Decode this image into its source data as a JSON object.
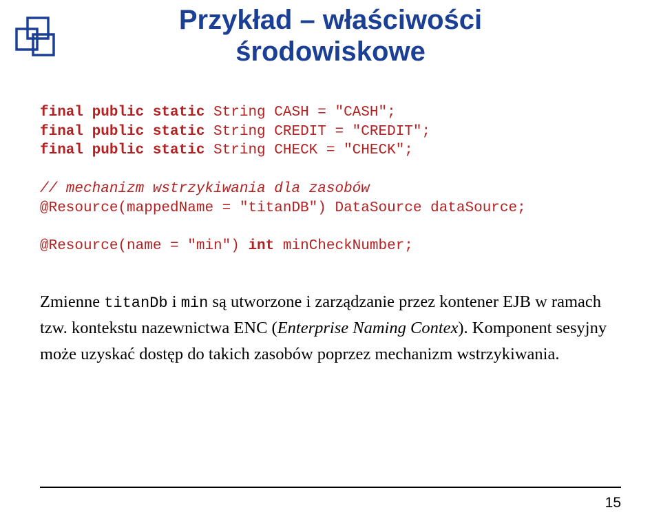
{
  "title_line1": "Przykład – właściwości",
  "title_line2": "środowiskowe",
  "code": {
    "l1a": "final public static ",
    "l1b": "String CASH = \"CASH\";",
    "l2a": "final public static ",
    "l2b": "String CREDIT = \"CREDIT\";",
    "l3a": "final public static ",
    "l3b": "String CHECK = \"CHECK\";",
    "l4": "// mechanizm wstrzykiwania dla zasobów",
    "l5": "@Resource(mappedName = \"titanDB\") DataSource dataSource;",
    "l6a": "@Resource(name = \"min\") ",
    "l6kw": "int",
    "l6b": " minCheckNumber;"
  },
  "body": {
    "p1a": "Zmienne ",
    "var1": "titanDb",
    "p1b": " i ",
    "var2": "min",
    "p1c": " są utworzone i zarządzanie przez kontener EJB w ramach tzw. kontekstu nazewnictwa ENC (",
    "ital": "Enterprise Naming Contex",
    "p1d": "). Komponent sesyjny może uzyskać dostęp do takich zasobów poprzez mechanizm wstrzykiwania."
  },
  "page_number": "15"
}
